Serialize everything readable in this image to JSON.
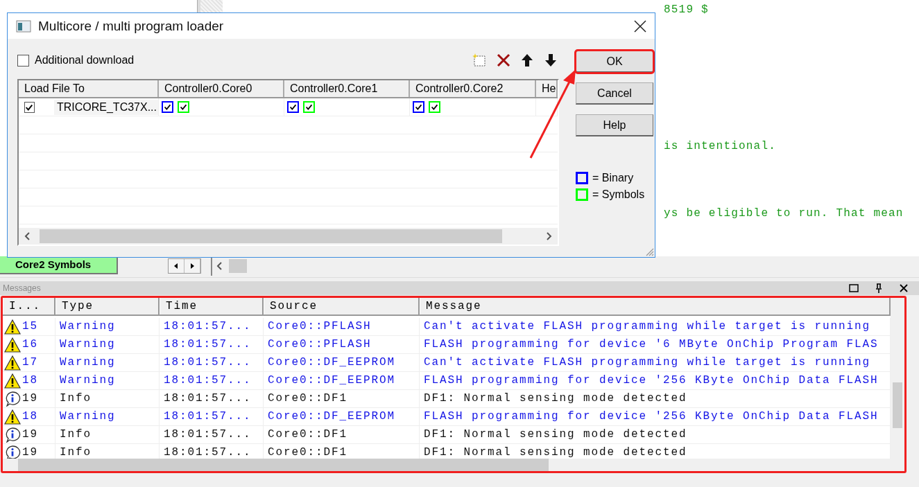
{
  "editor": {
    "lines": [
      {
        "text": "8519 $"
      },
      {
        "text": "is intentional."
      },
      {
        "text": "ys be eligible to run. That mean"
      }
    ]
  },
  "dialog": {
    "title": "Multicore / multi program loader",
    "additional_download": {
      "label": "Additional download",
      "checked": false
    },
    "buttons": [
      {
        "label": "OK",
        "highlighted": true
      },
      {
        "label": "Cancel",
        "highlighted": false
      },
      {
        "label": "Help",
        "highlighted": false
      }
    ],
    "grid": {
      "columns": [
        "Load File To",
        "Controller0.Core0",
        "Controller0.Core1",
        "Controller0.Core2",
        "He"
      ],
      "rows": [
        {
          "checked": true,
          "file": "TRICORE_TC37X...",
          "cores": [
            {
              "binary": true,
              "symbols": true
            },
            {
              "binary": true,
              "symbols": true
            },
            {
              "binary": true,
              "symbols": true
            }
          ]
        }
      ]
    },
    "legend": [
      {
        "label": "= Binary",
        "color": "#0000ff"
      },
      {
        "label": "= Symbols",
        "color": "#00ff00"
      }
    ]
  },
  "tabs": [
    {
      "label": "Core2 Symbols",
      "selected": true
    }
  ],
  "messages": {
    "title": "Messages",
    "highlighted": true,
    "columns": [
      "I...",
      "Type",
      "Time",
      "Source",
      "Message"
    ],
    "rows": [
      {
        "kind": "warning",
        "id": "15",
        "type": "Warning",
        "time": "18:01:57...",
        "source": "Core0::PFLASH",
        "message": "Can't activate FLASH programming while target is running"
      },
      {
        "kind": "warning",
        "id": "16",
        "type": "Warning",
        "time": "18:01:57...",
        "source": "Core0::PFLASH",
        "message": "FLASH programming for device '6 MByte OnChip Program FLAS"
      },
      {
        "kind": "warning",
        "id": "17",
        "type": "Warning",
        "time": "18:01:57...",
        "source": "Core0::DF_EEPROM",
        "message": "Can't activate FLASH programming while target is running"
      },
      {
        "kind": "warning",
        "id": "18",
        "type": "Warning",
        "time": "18:01:57...",
        "source": "Core0::DF_EEPROM",
        "message": "FLASH programming for device '256 KByte OnChip Data FLASH"
      },
      {
        "kind": "info",
        "id": "19",
        "type": "Info",
        "time": "18:01:57...",
        "source": "Core0::DF1",
        "message": "DF1: Normal sensing mode detected"
      },
      {
        "kind": "warning",
        "id": "18",
        "type": "Warning",
        "time": "18:01:57...",
        "source": "Core0::DF_EEPROM",
        "message": "FLASH programming for device '256 KByte OnChip Data FLASH"
      },
      {
        "kind": "info",
        "id": "19",
        "type": "Info",
        "time": "18:01:57...",
        "source": "Core0::DF1",
        "message": "DF1: Normal sensing mode detected"
      },
      {
        "kind": "info",
        "id": "19",
        "type": "Info",
        "time": "18:01:57...",
        "source": "Core0::DF1",
        "message": "DF1: Normal sensing mode detected"
      }
    ]
  }
}
